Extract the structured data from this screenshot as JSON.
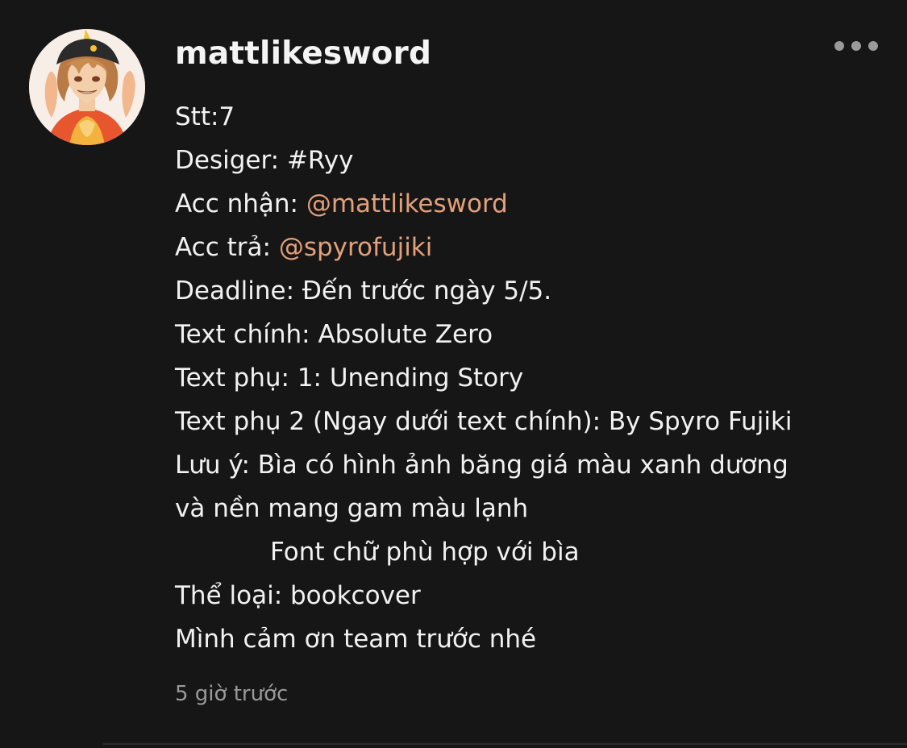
{
  "comment": {
    "username": "mattlikesword",
    "timestamp": "5 giờ trước",
    "more_icon": "more-horizontal-icon",
    "colors": {
      "background": "#161616",
      "text": "#f2f2f2",
      "mention": "#e3a07a",
      "muted": "#9a9a9a"
    },
    "lines": {
      "stt": "Stt:7",
      "designer": "Desiger: #Ryy",
      "acc_receive_label": "Acc nhận: ",
      "acc_receive_mention": "@mattlikesword",
      "acc_return_label": "Acc trả: ",
      "acc_return_mention": "@spyrofujiki",
      "deadline": "Deadline: Đến trước ngày 5/5.",
      "main_text": "Text chính: Absolute Zero",
      "sub_text_1": "Text phụ: 1: Unending Story",
      "sub_text_2": "Text phụ 2 (Ngay dưới text chính): By Spyro Fujiki",
      "note_1": "Lưu ý: Bìa có hình ảnh băng giá màu xanh dương",
      "note_2": "và nền mang gam màu lạnh",
      "note_3": "Font chữ phù hợp với bìa",
      "category": "Thể loại: bookcover",
      "thanks": "Mình cảm ơn team trước nhé"
    }
  }
}
